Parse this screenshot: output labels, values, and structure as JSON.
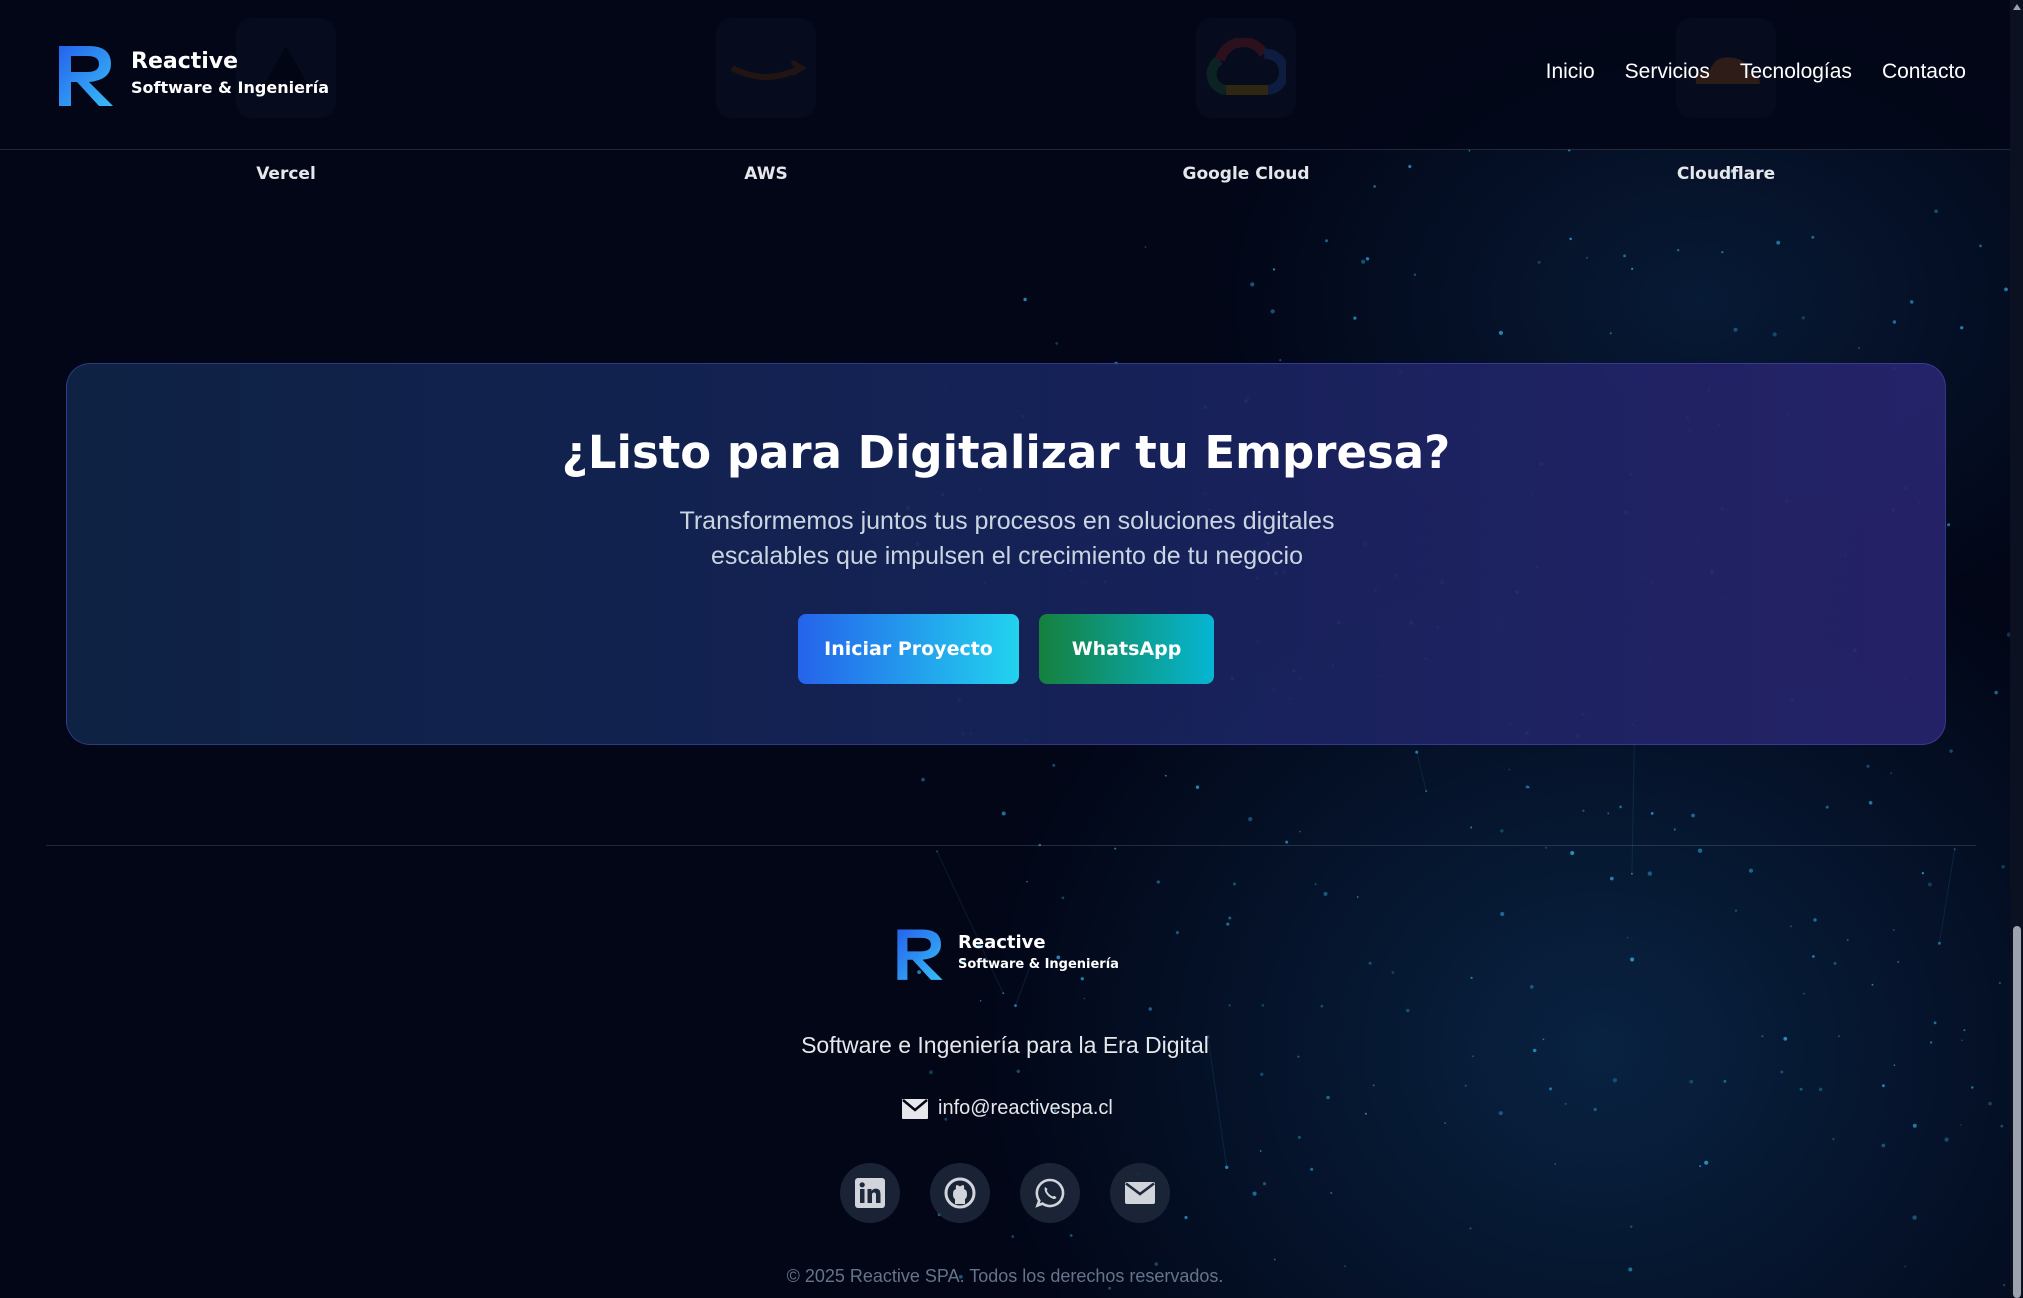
{
  "brand": {
    "name": "Reactive",
    "tagline": "Software & Ingeniería"
  },
  "nav": {
    "items": [
      "Inicio",
      "Servicios",
      "Tecnologías",
      "Contacto"
    ]
  },
  "technologies": [
    {
      "label": "Vercel",
      "icon": "vercel-icon"
    },
    {
      "label": "AWS",
      "icon": "aws-icon"
    },
    {
      "label": "Google Cloud",
      "icon": "google-cloud-icon"
    },
    {
      "label": "Cloudflare",
      "icon": "cloudflare-icon"
    }
  ],
  "cta": {
    "title": "¿Listo para Digitalizar tu Empresa?",
    "subtitle": "Transformemos juntos tus procesos en soluciones digitales escalables que impulsen el crecimiento de tu negocio",
    "primary_label": "Iniciar Proyecto",
    "whatsapp_label": "WhatsApp"
  },
  "footer": {
    "brand_name": "Reactive",
    "brand_tagline": "Software & Ingeniería",
    "tagline": "Software e Ingeniería para la Era Digital",
    "email": "info@reactivespa.cl",
    "socials": [
      "linkedin-icon",
      "github-icon",
      "whatsapp-icon",
      "mail-icon"
    ],
    "copyright": "© 2025 Reactive SPA. Todos los derechos reservados."
  },
  "colors": {
    "background": "#020617",
    "accent_blue": "#2563eb",
    "accent_cyan": "#22d3ee",
    "accent_green": "#15803d"
  }
}
